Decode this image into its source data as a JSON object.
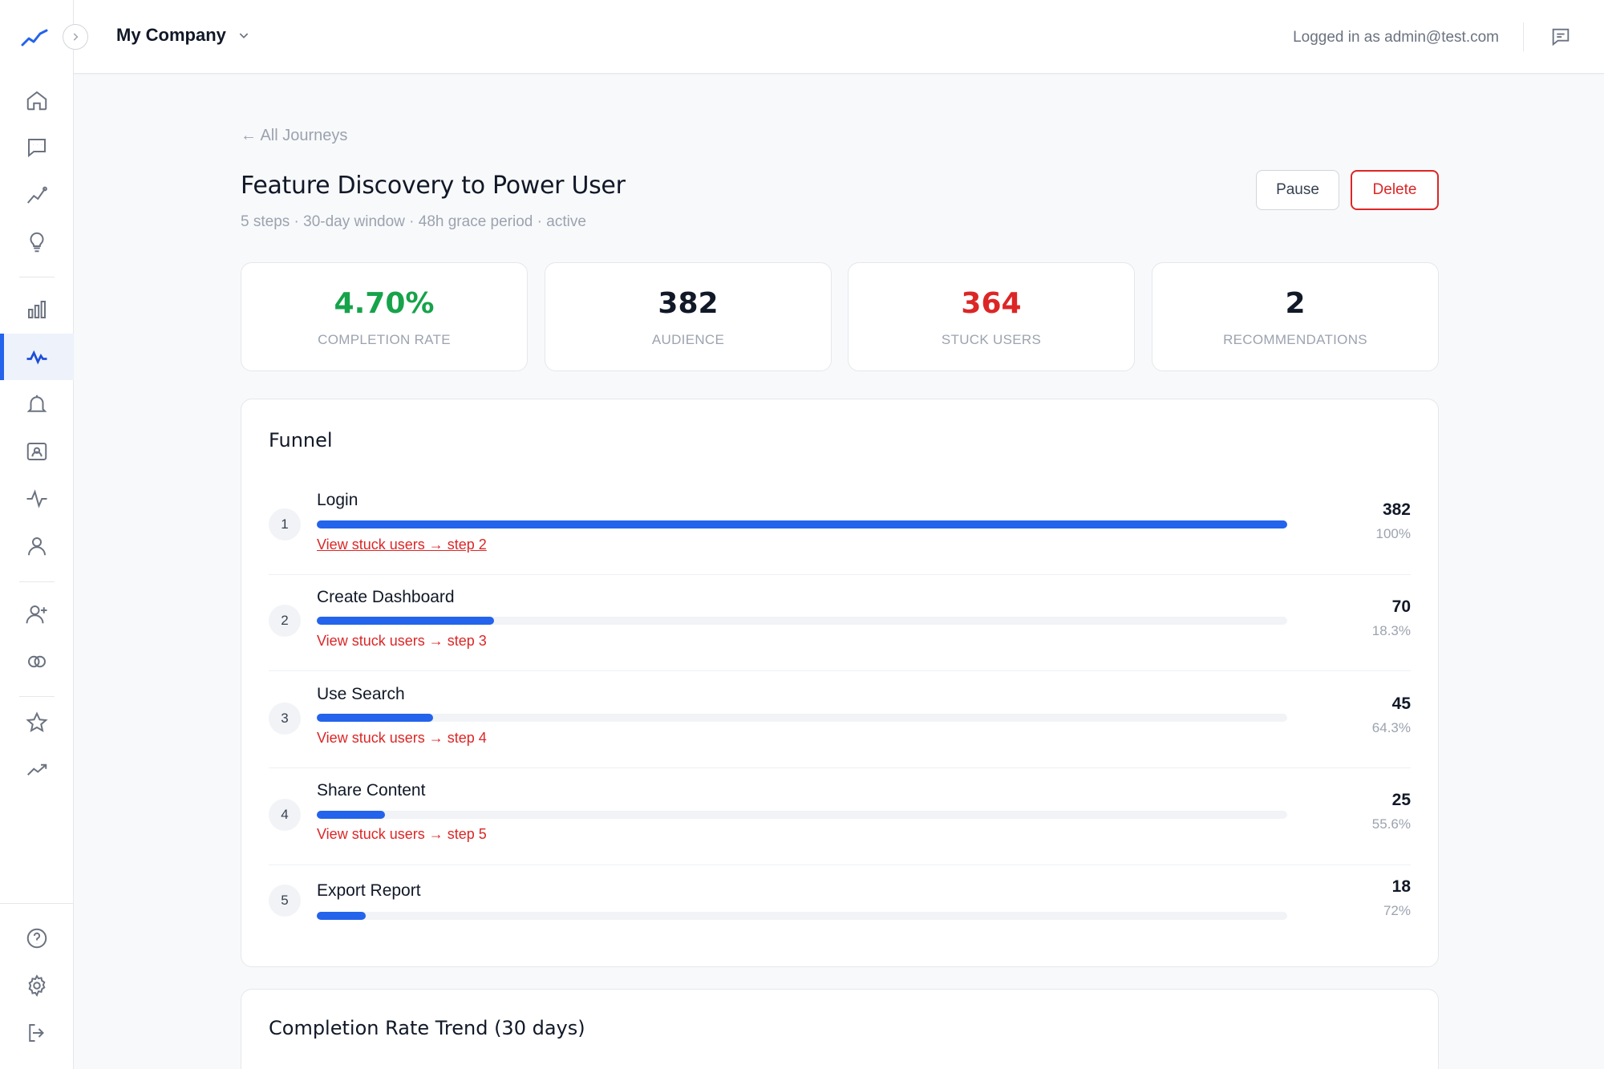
{
  "header": {
    "company": "My Company",
    "logged_in": "Logged in as admin@test.com"
  },
  "sidebar": {
    "items": [
      {
        "icon": "home-icon"
      },
      {
        "icon": "chat-icon"
      },
      {
        "icon": "trend-line-icon"
      },
      {
        "icon": "lightbulb-icon"
      },
      {
        "icon": "bar-chart-icon"
      },
      {
        "icon": "journey-pulse-icon",
        "active": true
      },
      {
        "icon": "bell-icon"
      },
      {
        "icon": "contact-card-icon"
      },
      {
        "icon": "activity-icon"
      },
      {
        "icon": "user-icon"
      },
      {
        "icon": "user-plus-icon"
      },
      {
        "icon": "segments-icon"
      },
      {
        "icon": "star-icon"
      },
      {
        "icon": "trending-icon"
      },
      {
        "icon": "help-icon"
      },
      {
        "icon": "settings-icon"
      },
      {
        "icon": "logout-icon"
      }
    ]
  },
  "page": {
    "back_link": "← All Journeys",
    "title": "Feature Discovery to Power User",
    "subtitle": "5 steps · 30-day window · 48h grace period · active",
    "pause_label": "Pause",
    "delete_label": "Delete"
  },
  "stats": [
    {
      "value": "4.70%",
      "label": "COMPLETION RATE",
      "color": "#16a34a"
    },
    {
      "value": "382",
      "label": "AUDIENCE",
      "color": "#111827"
    },
    {
      "value": "364",
      "label": "STUCK USERS",
      "color": "#dc2626"
    },
    {
      "value": "2",
      "label": "RECOMMENDATIONS",
      "color": "#111827"
    }
  ],
  "funnel": {
    "title": "Funnel",
    "steps": [
      {
        "num": "1",
        "name": "Login",
        "count": "382",
        "pct": "100%",
        "fill": 1.0,
        "stuck": "View stuck users → step 2"
      },
      {
        "num": "2",
        "name": "Create Dashboard",
        "count": "70",
        "pct": "18.3%",
        "fill": 0.183,
        "stuck": "View stuck users → step 3"
      },
      {
        "num": "3",
        "name": "Use Search",
        "count": "45",
        "pct": "64.3%",
        "fill": 0.12,
        "stuck": "View stuck users → step 4"
      },
      {
        "num": "4",
        "name": "Share Content",
        "count": "25",
        "pct": "55.6%",
        "fill": 0.07,
        "stuck": "View stuck users → step 5"
      },
      {
        "num": "5",
        "name": "Export Report",
        "count": "18",
        "pct": "72%",
        "fill": 0.05,
        "stuck": ""
      }
    ]
  },
  "trend": {
    "title": "Completion Rate Trend (30 days)"
  },
  "colors": {
    "accent": "#2463eb",
    "danger": "#dc2626",
    "success": "#16a34a"
  }
}
